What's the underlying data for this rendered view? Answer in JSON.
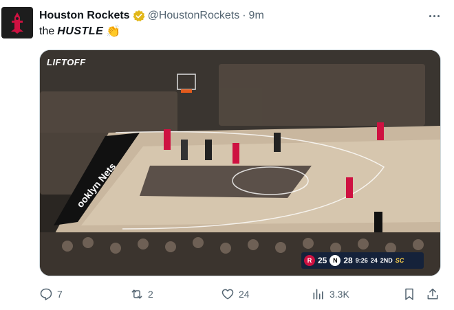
{
  "tweet": {
    "display_name": "Houston Rockets",
    "handle": "@HoustonRockets",
    "separator": "·",
    "time": "9m",
    "text_prefix": "the",
    "text_emphasis": "HUSTLE",
    "text_emoji": "👏"
  },
  "media": {
    "overlay_brand": "LIFTOFF",
    "scorebug": {
      "home_score": "25",
      "away_score": "28",
      "clock": "9:26",
      "shot_clock": "24",
      "period": "2ND",
      "network": "SC",
      "home_logo_letter": "R",
      "away_logo_letter": "N"
    }
  },
  "actions": {
    "replies": "7",
    "reposts": "2",
    "likes": "24",
    "views": "3.3K"
  },
  "colors": {
    "text_primary": "#0f1419",
    "text_secondary": "#536471",
    "verified_gold": "#e2b719",
    "rockets_red": "#ce1141"
  }
}
